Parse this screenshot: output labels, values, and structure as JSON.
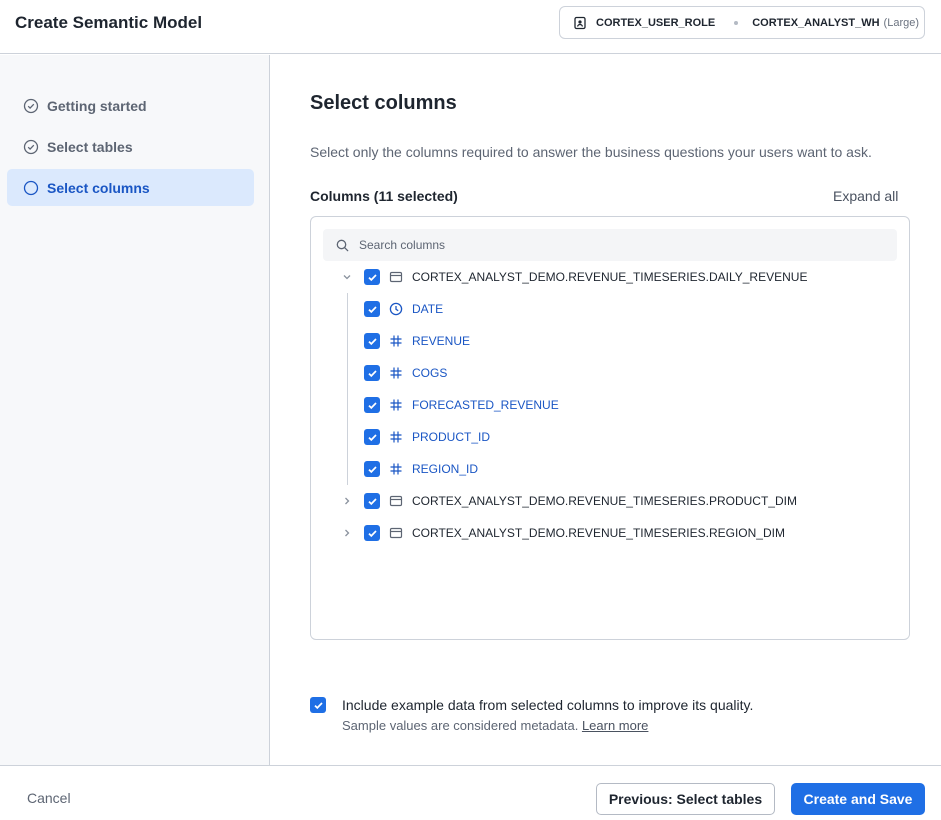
{
  "header": {
    "title": "Create Semantic Model",
    "role": "CORTEX_USER_ROLE",
    "warehouse": "CORTEX_ANALYST_WH",
    "warehouse_size": "(Large)"
  },
  "sidebar": {
    "steps": [
      {
        "label": "Getting started",
        "state": "done",
        "icon": "check-circle-icon"
      },
      {
        "label": "Select tables",
        "state": "done",
        "icon": "check-circle-icon"
      },
      {
        "label": "Select columns",
        "state": "active",
        "icon": "circle-icon"
      }
    ]
  },
  "main": {
    "title": "Select columns",
    "description": "Select only the columns required to answer the business questions your users want to ask.",
    "columns_label": "Columns (11 selected)",
    "expand_all": "Expand all",
    "search": {
      "placeholder": "Search columns",
      "value": ""
    },
    "tree": [
      {
        "type": "table",
        "label": "CORTEX_ANALYST_DEMO.REVENUE_TIMESERIES.DAILY_REVENUE",
        "expanded": true,
        "checked": true,
        "icon": "table-icon"
      },
      {
        "type": "column",
        "label": "DATE",
        "checked": true,
        "icon": "clock-icon"
      },
      {
        "type": "column",
        "label": "REVENUE",
        "checked": true,
        "icon": "hash-icon"
      },
      {
        "type": "column",
        "label": "COGS",
        "checked": true,
        "icon": "hash-icon"
      },
      {
        "type": "column",
        "label": "FORECASTED_REVENUE",
        "checked": true,
        "icon": "hash-icon"
      },
      {
        "type": "column",
        "label": "PRODUCT_ID",
        "checked": true,
        "icon": "hash-icon"
      },
      {
        "type": "column",
        "label": "REGION_ID",
        "checked": true,
        "icon": "hash-icon"
      },
      {
        "type": "table",
        "label": "CORTEX_ANALYST_DEMO.REVENUE_TIMESERIES.PRODUCT_DIM",
        "expanded": false,
        "checked": true,
        "icon": "table-icon"
      },
      {
        "type": "table",
        "label": "CORTEX_ANALYST_DEMO.REVENUE_TIMESERIES.REGION_DIM",
        "expanded": false,
        "checked": true,
        "icon": "table-icon"
      }
    ],
    "include": {
      "checked": true,
      "label": "Include example data from selected columns to improve its quality.",
      "sub": "Sample values are considered metadata.",
      "learn_more": "Learn more"
    }
  },
  "footer": {
    "cancel": "Cancel",
    "previous": "Previous: Select tables",
    "save": "Create and Save"
  },
  "colors": {
    "accent": "#1f6fe5",
    "active_step_bg": "#dbe9fd",
    "column_text": "#1a56c4"
  }
}
